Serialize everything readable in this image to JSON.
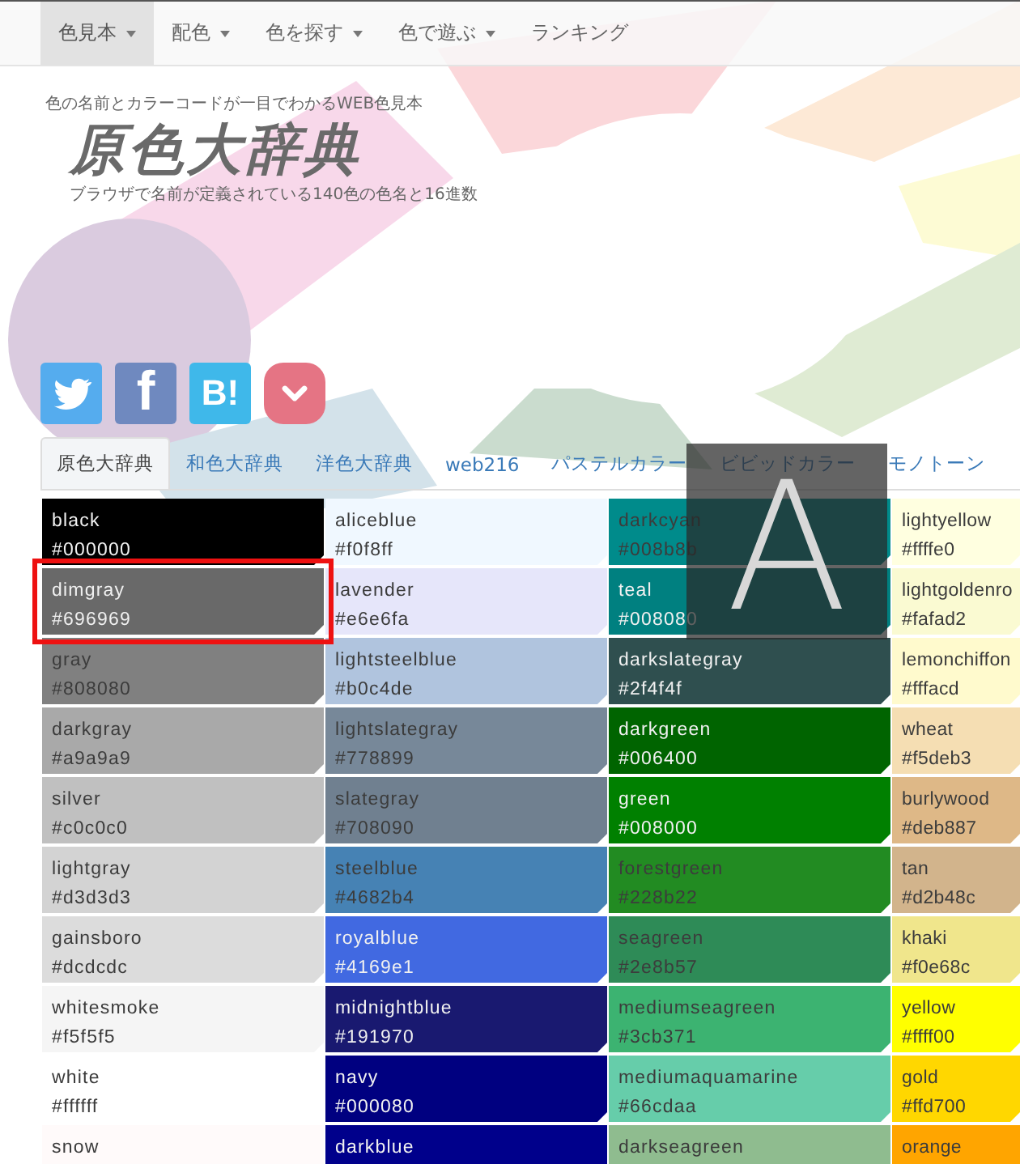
{
  "nav": [
    {
      "label": "色見本",
      "dropdown": true,
      "selected": true
    },
    {
      "label": "配色",
      "dropdown": true,
      "selected": false
    },
    {
      "label": "色を探す",
      "dropdown": true,
      "selected": false
    },
    {
      "label": "色で遊ぶ",
      "dropdown": true,
      "selected": false
    },
    {
      "label": "ランキング",
      "dropdown": false,
      "selected": false
    }
  ],
  "header": {
    "tagline": "色の名前とカラーコードが一目でわかるWEB色見本",
    "logo": "原色大辞典",
    "subtitle": "ブラウザで名前が定義されている140色の色名と16進数"
  },
  "share_buttons": [
    {
      "kind": "twitter"
    },
    {
      "kind": "facebook",
      "label": "f"
    },
    {
      "kind": "hatena",
      "label": "B!"
    },
    {
      "kind": "pocket"
    }
  ],
  "tabs": [
    {
      "label": "原色大辞典",
      "selected": true
    },
    {
      "label": "和色大辞典",
      "selected": false
    },
    {
      "label": "洋色大辞典",
      "selected": false
    },
    {
      "label": "web216",
      "selected": false
    },
    {
      "label": "パステルカラー",
      "selected": false
    },
    {
      "label": "ビビッドカラー",
      "selected": false
    },
    {
      "label": "モノトーン",
      "selected": false
    }
  ],
  "swatch_columns": [
    [
      {
        "name": "black",
        "code": "#000000",
        "color": "#000000",
        "light_text": true,
        "selected": false
      },
      {
        "name": "dimgray",
        "code": "#696969",
        "color": "#696969",
        "light_text": true,
        "selected": true
      },
      {
        "name": "gray",
        "code": "#808080",
        "color": "#808080",
        "light_text": false,
        "selected": false
      },
      {
        "name": "darkgray",
        "code": "#a9a9a9",
        "color": "#a9a9a9",
        "light_text": false,
        "selected": false
      },
      {
        "name": "silver",
        "code": "#c0c0c0",
        "color": "#c0c0c0",
        "light_text": false,
        "selected": false
      },
      {
        "name": "lightgray",
        "code": "#d3d3d3",
        "color": "#d3d3d3",
        "light_text": false,
        "selected": false
      },
      {
        "name": "gainsboro",
        "code": "#dcdcdc",
        "color": "#dcdcdc",
        "light_text": false,
        "selected": false
      },
      {
        "name": "whitesmoke",
        "code": "#f5f5f5",
        "color": "#f5f5f5",
        "light_text": false,
        "selected": false
      },
      {
        "name": "white",
        "code": "#ffffff",
        "color": "#ffffff",
        "light_text": false,
        "selected": false
      },
      {
        "name": "snow",
        "color": "#fffafa",
        "light_text": false,
        "selected": false
      }
    ],
    [
      {
        "name": "aliceblue",
        "code": "#f0f8ff",
        "color": "#f0f8ff",
        "light_text": false,
        "selected": false
      },
      {
        "name": "lavender",
        "code": "#e6e6fa",
        "color": "#e6e6fa",
        "light_text": false,
        "selected": false
      },
      {
        "name": "lightsteelblue",
        "code": "#b0c4de",
        "color": "#b0c4de",
        "light_text": false,
        "selected": false
      },
      {
        "name": "lightslategray",
        "code": "#778899",
        "color": "#778899",
        "light_text": false,
        "selected": false
      },
      {
        "name": "slategray",
        "code": "#708090",
        "color": "#708090",
        "light_text": false,
        "selected": false
      },
      {
        "name": "steelblue",
        "code": "#4682b4",
        "color": "#4682b4",
        "light_text": false,
        "selected": false
      },
      {
        "name": "royalblue",
        "code": "#4169e1",
        "color": "#4169e1",
        "light_text": true,
        "selected": false
      },
      {
        "name": "midnightblue",
        "code": "#191970",
        "color": "#191970",
        "light_text": true,
        "selected": false
      },
      {
        "name": "navy",
        "code": "#000080",
        "color": "#000080",
        "light_text": true,
        "selected": false
      },
      {
        "name": "darkblue",
        "color": "#00008b",
        "light_text": true,
        "selected": false
      }
    ],
    [
      {
        "name": "darkcyan",
        "code": "#008b8b",
        "color": "#008b8b",
        "light_text": false,
        "selected": false
      },
      {
        "name": "teal",
        "code": "#008080",
        "color": "#008080",
        "light_text": true,
        "selected": false
      },
      {
        "name": "darkslategray",
        "code": "#2f4f4f",
        "color": "#2f4f4f",
        "light_text": true,
        "selected": false
      },
      {
        "name": "darkgreen",
        "code": "#006400",
        "color": "#006400",
        "light_text": true,
        "selected": false
      },
      {
        "name": "green",
        "code": "#008000",
        "color": "#008000",
        "light_text": true,
        "selected": false
      },
      {
        "name": "forestgreen",
        "code": "#228b22",
        "color": "#228b22",
        "light_text": false,
        "selected": false
      },
      {
        "name": "seagreen",
        "code": "#2e8b57",
        "color": "#2e8b57",
        "light_text": false,
        "selected": false
      },
      {
        "name": "mediumseagreen",
        "code": "#3cb371",
        "color": "#3cb371",
        "light_text": false,
        "selected": false
      },
      {
        "name": "mediumaquamarine",
        "code": "#66cdaa",
        "color": "#66cdaa",
        "light_text": false,
        "selected": false
      },
      {
        "name": "darkseagreen",
        "color": "#8fbc8f",
        "light_text": false,
        "selected": false
      }
    ],
    [
      {
        "name": "lightyellow",
        "code": "#ffffe0",
        "color": "#ffffe0",
        "light_text": false,
        "selected": false
      },
      {
        "name": "lightgoldenro",
        "code": "#fafad2",
        "color": "#fafad2",
        "light_text": false,
        "selected": false
      },
      {
        "name": "lemonchiffon",
        "code": "#fffacd",
        "color": "#fffacd",
        "light_text": false,
        "selected": false
      },
      {
        "name": "wheat",
        "code": "#f5deb3",
        "color": "#f5deb3",
        "light_text": false,
        "selected": false
      },
      {
        "name": "burlywood",
        "code": "#deb887",
        "color": "#deb887",
        "light_text": false,
        "selected": false
      },
      {
        "name": "tan",
        "code": "#d2b48c",
        "color": "#d2b48c",
        "light_text": false,
        "selected": false
      },
      {
        "name": "khaki",
        "code": "#f0e68c",
        "color": "#f0e68c",
        "light_text": false,
        "selected": false
      },
      {
        "name": "yellow",
        "code": "#ffff00",
        "color": "#ffff00",
        "light_text": false,
        "selected": false
      },
      {
        "name": "gold",
        "code": "#ffd700",
        "color": "#ffd700",
        "light_text": false,
        "selected": false
      },
      {
        "name": "orange",
        "color": "#ffa500",
        "light_text": false,
        "selected": false
      }
    ]
  ],
  "font_size_overlay": {
    "label": "A"
  }
}
